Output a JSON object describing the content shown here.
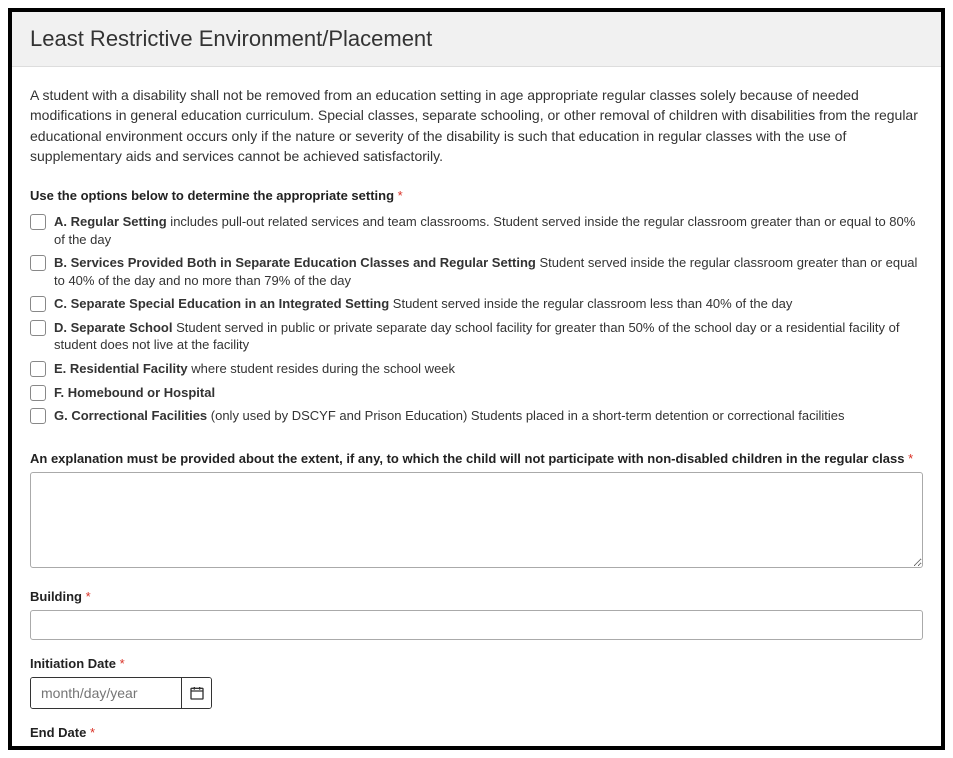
{
  "header": {
    "title": "Least Restrictive Environment/Placement"
  },
  "intro": "A student with a disability shall not be removed from an education setting in age appropriate regular classes solely because of needed modifications in general education curriculum. Special classes, separate schooling, or other removal of children with disabilities from the regular educational environment occurs only if the nature or severity of the disability is such that education in regular classes with the use of supplementary aids and services cannot be achieved satisfactorily.",
  "options_label": "Use the options below to determine the appropriate setting",
  "required_marker": "*",
  "options": [
    {
      "lead": "A. Regular Setting",
      "rest": " includes pull-out related services and team classrooms. Student served inside the regular classroom greater than or equal to 80% of the day"
    },
    {
      "lead": "B. Services Provided Both in Separate Education Classes and Regular Setting",
      "rest": " Student served inside the regular classroom greater than or equal to 40% of the day and no more than 79% of the day"
    },
    {
      "lead": "C. Separate Special Education in an Integrated Setting",
      "rest": " Student served inside the regular classroom less than 40% of the day"
    },
    {
      "lead": "D. Separate School",
      "rest": " Student served in public or private separate day school facility for greater than 50% of the school day or a residential facility of student does not live at the facility"
    },
    {
      "lead": "E. Residential Facility",
      "rest": " where student resides during the school week"
    },
    {
      "lead": "F. Homebound or Hospital",
      "rest": ""
    },
    {
      "lead": "G. Correctional Facilities",
      "rest": " (only used by DSCYF and Prison Education) Students placed in a short-term detention or correctional facilities"
    }
  ],
  "explanation_label": "An explanation must be provided about the extent, if any, to which the child will not participate with non-disabled children in the regular class",
  "explanation_value": "",
  "building_label": "Building",
  "building_value": "",
  "initiation_label": "Initiation Date",
  "initiation_placeholder": "month/day/year",
  "end_label": "End Date"
}
